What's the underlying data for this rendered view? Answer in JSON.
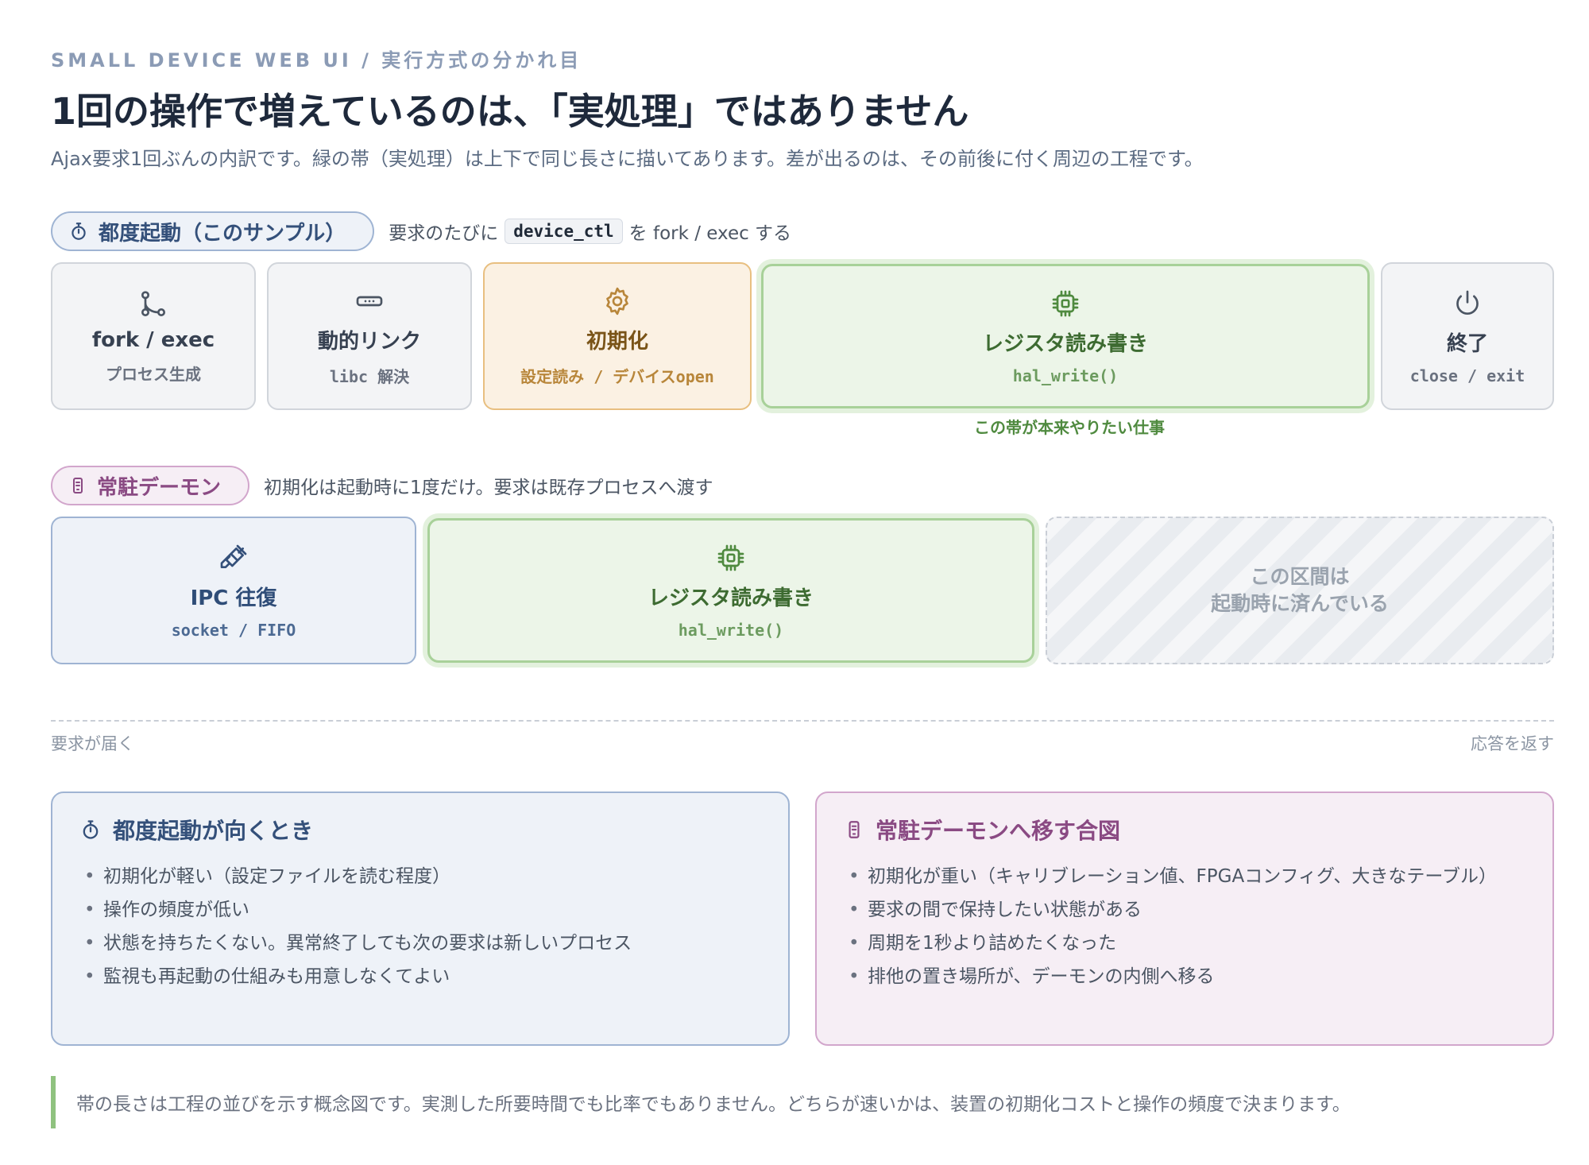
{
  "header": {
    "eyebrow": "SMALL DEVICE WEB UI / 実行方式の分かれ目",
    "title": "1回の操作で増えているのは、「実処理」ではありません",
    "subtitle": "Ajax要求1回ぶんの内訳です。緑の帯（実処理）は上下で同じ長さに描いてあります。差が出るのは、その前後に付く周辺の工程です。"
  },
  "per_request": {
    "pill": "都度起動（このサンプル）",
    "desc_before": "要求のたびに",
    "desc_code": "device_ctl",
    "desc_after": "を fork / exec する",
    "steps": [
      {
        "icon": "fork-icon",
        "label": "fork / exec",
        "sub": "プロセス生成"
      },
      {
        "icon": "link-icon",
        "label": "動的リンク",
        "sub": "libc 解決"
      },
      {
        "icon": "gear-icon",
        "label": "初期化",
        "sub": "設定読み / デバイスopen"
      },
      {
        "icon": "chip-icon",
        "label": "レジスタ読み書き",
        "sub": "hal_write()"
      },
      {
        "icon": "power-icon",
        "label": "終了",
        "sub": "close / exit"
      }
    ],
    "green_caption": "この帯が本来やりたい仕事"
  },
  "daemon": {
    "pill": "常駐デーモン",
    "desc": "初期化は起動時に1度だけ。要求は既存プロセスへ渡す",
    "steps": [
      {
        "icon": "plug-icon",
        "label": "IPC 往復",
        "sub": "socket / FIFO"
      },
      {
        "icon": "chip-icon",
        "label": "レジスタ読み書き",
        "sub": "hal_write()"
      }
    ],
    "skipped_line1": "この区間は",
    "skipped_line2": "起動時に済んでいる"
  },
  "axis": {
    "left": "要求が届く",
    "right": "応答を返す"
  },
  "cards": {
    "per_request": {
      "title": "都度起動が向くとき",
      "items": [
        "初期化が軽い（設定ファイルを読む程度）",
        "操作の頻度が低い",
        "状態を持ちたくない。異常終了しても次の要求は新しいプロセス",
        "監視も再起動の仕組みも用意しなくてよい"
      ]
    },
    "daemon": {
      "title": "常駐デーモンへ移す合図",
      "items": [
        "初期化が重い（キャリブレーション値、FPGAコンフィグ、大きなテーブル）",
        "要求の間で保持したい状態がある",
        "周期を1秒より詰めたくなった",
        "排他の置き場所が、デーモンの内側へ移る"
      ]
    }
  },
  "note": "帯の長さは工程の並びを示す概念図です。実測した所要時間でも比率でもありません。どちらが速いかは、装置の初期化コストと操作の頻度で決まります。",
  "colors": {
    "blue_accent": "#34507a",
    "pink_accent": "#8a4a83",
    "green_accent": "#4f8a3f",
    "orange_accent": "#b8863a"
  }
}
